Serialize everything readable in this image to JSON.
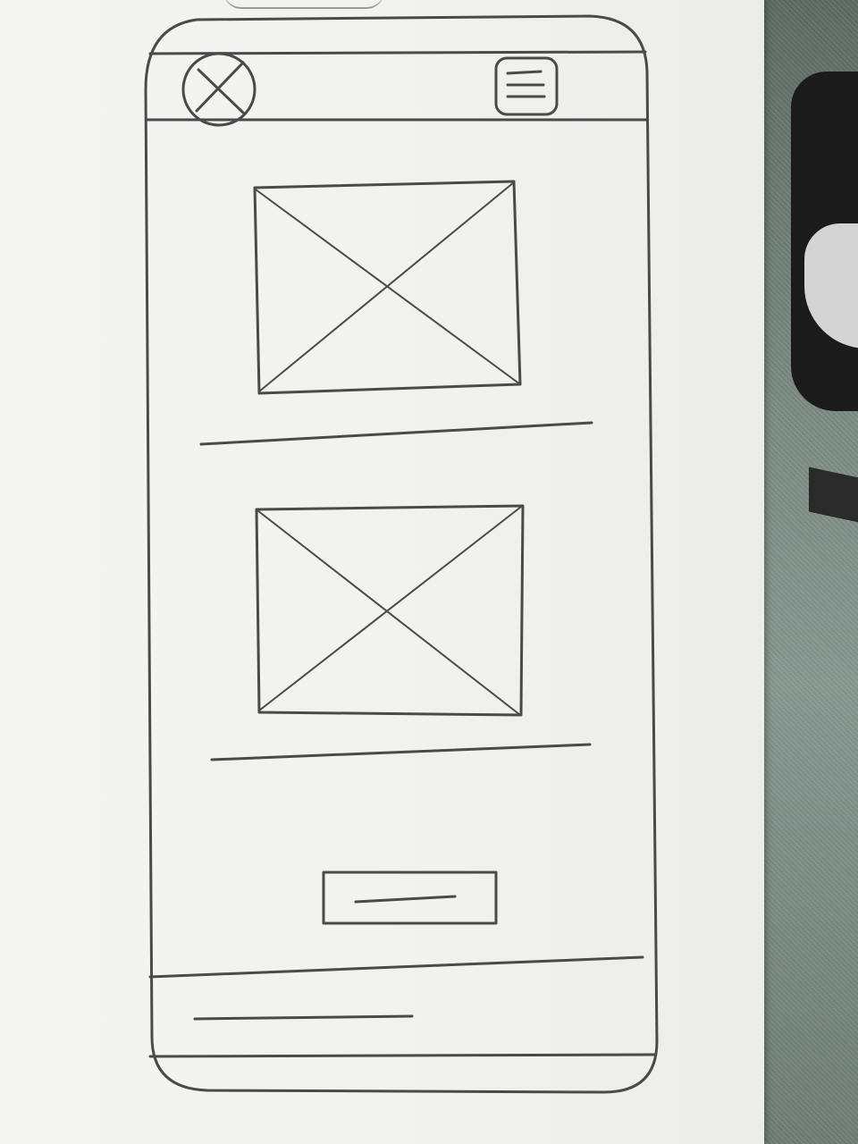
{
  "wireframe": {
    "header": {
      "logo_icon": "image-placeholder-circle-icon",
      "menu_icon": "hamburger-menu-icon"
    },
    "content": {
      "image_placeholders": [
        "image-placeholder-1",
        "image-placeholder-2"
      ],
      "caption_lines": 2
    },
    "button": {
      "label_icon": "text-line-placeholder"
    },
    "footer": {
      "text_icon": "text-line-placeholder"
    }
  },
  "colors": {
    "pencil": "#4a4a4a",
    "paper": "#f1f1ef",
    "fabric": "#7a8a82"
  }
}
